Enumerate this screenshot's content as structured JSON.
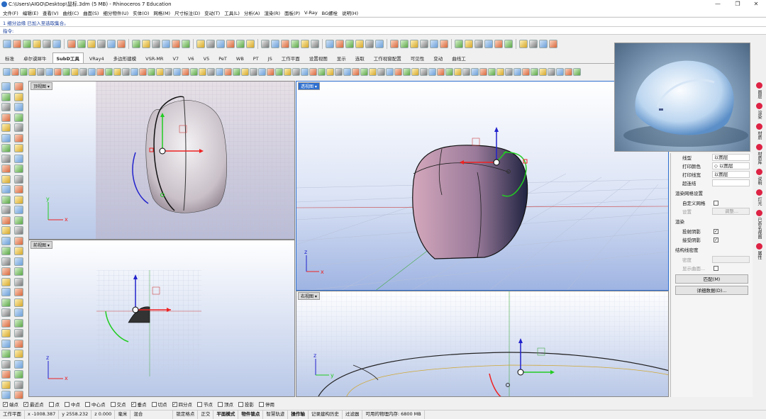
{
  "window": {
    "title": "C:\\Users\\AIGO\\Desktop\\鼠标.3dm (5 MB) - Rhinoceros 7 Education",
    "min": "—",
    "max": "❐",
    "close": "✕"
  },
  "menu": [
    "文件(F)",
    "编辑(E)",
    "查看(V)",
    "曲线(C)",
    "曲面(S)",
    "细分物件(U)",
    "实体(O)",
    "网格(M)",
    "尺寸标注(D)",
    "变动(T)",
    "工具(L)",
    "分析(A)",
    "渲染(R)",
    "面板(P)",
    "V-Ray",
    "BG螺栓",
    "说明(H)"
  ],
  "command": {
    "history": "1 细分边缘 已加入至选取集合。",
    "prompt": "指令:",
    "value": ""
  },
  "tabs": [
    "标准",
    "卓尔谟犀牛",
    "SubD工具",
    "VRay4",
    "多边形建模",
    "VSR-MR",
    "V7",
    "V6",
    "V5",
    "PeT",
    "WB",
    "PT",
    "JS",
    "工作平面",
    "设置视图",
    "显示",
    "选取",
    "工作视窗配置",
    "可见性",
    "变动",
    "曲线工"
  ],
  "active_tab": "SubD工具",
  "viewports": {
    "top": "顶视图",
    "front": "前视图",
    "perspective": "透视图",
    "right": "右视图"
  },
  "axes": {
    "x": "x",
    "y": "y",
    "z": "z"
  },
  "properties": {
    "rows": [
      {
        "k": "线型",
        "v": "以图层"
      },
      {
        "k": "打印颜色",
        "v": "◇ 以图层"
      },
      {
        "k": "打印线宽",
        "v": "以图层"
      },
      {
        "k": "超连结",
        "v": ""
      }
    ],
    "render_mesh_section": "渲染网格设置",
    "custom_mesh": "自定义网格",
    "settings": "设置",
    "adjust_button": "调整...",
    "render_section": "渲染",
    "cast_shadows": "投射阴影",
    "receive_shadows": "接受阴影",
    "isocurve_section": "结构线密度",
    "density": "密度",
    "show_curves": "显示曲面...",
    "match_button": "匹配(M)",
    "details_button": "详细数据(D)..."
  },
  "right_tabs": [
    "图层",
    "渲染",
    "材质",
    "材质库",
    "说明",
    "灯光",
    "已命名视图",
    "属性"
  ],
  "osnaps": [
    {
      "label": "端点",
      "on": true
    },
    {
      "label": "最近点",
      "on": true
    },
    {
      "label": "点",
      "on": false
    },
    {
      "label": "中点",
      "on": false
    },
    {
      "label": "中心点",
      "on": false
    },
    {
      "label": "交点",
      "on": false
    },
    {
      "label": "垂点",
      "on": true
    },
    {
      "label": "切点",
      "on": false
    },
    {
      "label": "四分点",
      "on": true
    },
    {
      "label": "节点",
      "on": false
    },
    {
      "label": "顶点",
      "on": false
    },
    {
      "label": "投影",
      "on": false
    },
    {
      "label": "停用",
      "on": false
    }
  ],
  "status": {
    "cplane": "工作平面",
    "x": "x -1008.387",
    "y": "y 2558.232",
    "z": "z 0.000",
    "unit": "毫米",
    "layer": "混合",
    "lock_grid": "锁定格点",
    "ortho": "正交",
    "planar": "平面模式",
    "osnap": "物件锁点",
    "smarttrack": "智慧轨迹",
    "gumball": "操作轴",
    "history": "记录建构历史",
    "filter": "过滤器",
    "memory": "可用的物理内存: 6800 MB"
  }
}
